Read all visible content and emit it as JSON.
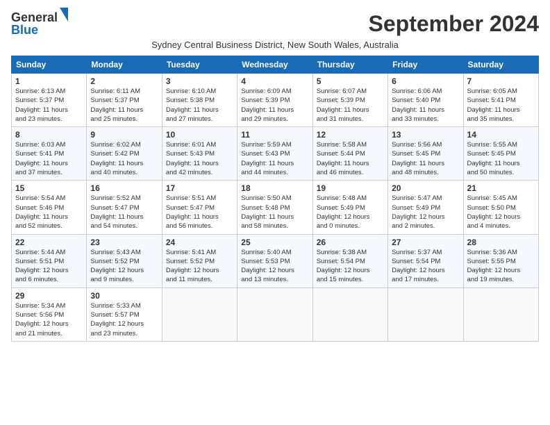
{
  "header": {
    "logo_general": "General",
    "logo_blue": "Blue",
    "month_title": "September 2024",
    "subtitle": "Sydney Central Business District, New South Wales, Australia"
  },
  "days_of_week": [
    "Sunday",
    "Monday",
    "Tuesday",
    "Wednesday",
    "Thursday",
    "Friday",
    "Saturday"
  ],
  "weeks": [
    [
      {
        "day": "1",
        "info": "Sunrise: 6:13 AM\nSunset: 5:37 PM\nDaylight: 11 hours\nand 23 minutes."
      },
      {
        "day": "2",
        "info": "Sunrise: 6:11 AM\nSunset: 5:37 PM\nDaylight: 11 hours\nand 25 minutes."
      },
      {
        "day": "3",
        "info": "Sunrise: 6:10 AM\nSunset: 5:38 PM\nDaylight: 11 hours\nand 27 minutes."
      },
      {
        "day": "4",
        "info": "Sunrise: 6:09 AM\nSunset: 5:39 PM\nDaylight: 11 hours\nand 29 minutes."
      },
      {
        "day": "5",
        "info": "Sunrise: 6:07 AM\nSunset: 5:39 PM\nDaylight: 11 hours\nand 31 minutes."
      },
      {
        "day": "6",
        "info": "Sunrise: 6:06 AM\nSunset: 5:40 PM\nDaylight: 11 hours\nand 33 minutes."
      },
      {
        "day": "7",
        "info": "Sunrise: 6:05 AM\nSunset: 5:41 PM\nDaylight: 11 hours\nand 35 minutes."
      }
    ],
    [
      {
        "day": "8",
        "info": "Sunrise: 6:03 AM\nSunset: 5:41 PM\nDaylight: 11 hours\nand 37 minutes."
      },
      {
        "day": "9",
        "info": "Sunrise: 6:02 AM\nSunset: 5:42 PM\nDaylight: 11 hours\nand 40 minutes."
      },
      {
        "day": "10",
        "info": "Sunrise: 6:01 AM\nSunset: 5:43 PM\nDaylight: 11 hours\nand 42 minutes."
      },
      {
        "day": "11",
        "info": "Sunrise: 5:59 AM\nSunset: 5:43 PM\nDaylight: 11 hours\nand 44 minutes."
      },
      {
        "day": "12",
        "info": "Sunrise: 5:58 AM\nSunset: 5:44 PM\nDaylight: 11 hours\nand 46 minutes."
      },
      {
        "day": "13",
        "info": "Sunrise: 5:56 AM\nSunset: 5:45 PM\nDaylight: 11 hours\nand 48 minutes."
      },
      {
        "day": "14",
        "info": "Sunrise: 5:55 AM\nSunset: 5:45 PM\nDaylight: 11 hours\nand 50 minutes."
      }
    ],
    [
      {
        "day": "15",
        "info": "Sunrise: 5:54 AM\nSunset: 5:46 PM\nDaylight: 11 hours\nand 52 minutes."
      },
      {
        "day": "16",
        "info": "Sunrise: 5:52 AM\nSunset: 5:47 PM\nDaylight: 11 hours\nand 54 minutes."
      },
      {
        "day": "17",
        "info": "Sunrise: 5:51 AM\nSunset: 5:47 PM\nDaylight: 11 hours\nand 56 minutes."
      },
      {
        "day": "18",
        "info": "Sunrise: 5:50 AM\nSunset: 5:48 PM\nDaylight: 11 hours\nand 58 minutes."
      },
      {
        "day": "19",
        "info": "Sunrise: 5:48 AM\nSunset: 5:49 PM\nDaylight: 12 hours\nand 0 minutes."
      },
      {
        "day": "20",
        "info": "Sunrise: 5:47 AM\nSunset: 5:49 PM\nDaylight: 12 hours\nand 2 minutes."
      },
      {
        "day": "21",
        "info": "Sunrise: 5:45 AM\nSunset: 5:50 PM\nDaylight: 12 hours\nand 4 minutes."
      }
    ],
    [
      {
        "day": "22",
        "info": "Sunrise: 5:44 AM\nSunset: 5:51 PM\nDaylight: 12 hours\nand 6 minutes."
      },
      {
        "day": "23",
        "info": "Sunrise: 5:43 AM\nSunset: 5:52 PM\nDaylight: 12 hours\nand 9 minutes."
      },
      {
        "day": "24",
        "info": "Sunrise: 5:41 AM\nSunset: 5:52 PM\nDaylight: 12 hours\nand 11 minutes."
      },
      {
        "day": "25",
        "info": "Sunrise: 5:40 AM\nSunset: 5:53 PM\nDaylight: 12 hours\nand 13 minutes."
      },
      {
        "day": "26",
        "info": "Sunrise: 5:38 AM\nSunset: 5:54 PM\nDaylight: 12 hours\nand 15 minutes."
      },
      {
        "day": "27",
        "info": "Sunrise: 5:37 AM\nSunset: 5:54 PM\nDaylight: 12 hours\nand 17 minutes."
      },
      {
        "day": "28",
        "info": "Sunrise: 5:36 AM\nSunset: 5:55 PM\nDaylight: 12 hours\nand 19 minutes."
      }
    ],
    [
      {
        "day": "29",
        "info": "Sunrise: 5:34 AM\nSunset: 5:56 PM\nDaylight: 12 hours\nand 21 minutes."
      },
      {
        "day": "30",
        "info": "Sunrise: 5:33 AM\nSunset: 5:57 PM\nDaylight: 12 hours\nand 23 minutes."
      },
      {
        "day": "",
        "info": ""
      },
      {
        "day": "",
        "info": ""
      },
      {
        "day": "",
        "info": ""
      },
      {
        "day": "",
        "info": ""
      },
      {
        "day": "",
        "info": ""
      }
    ]
  ]
}
